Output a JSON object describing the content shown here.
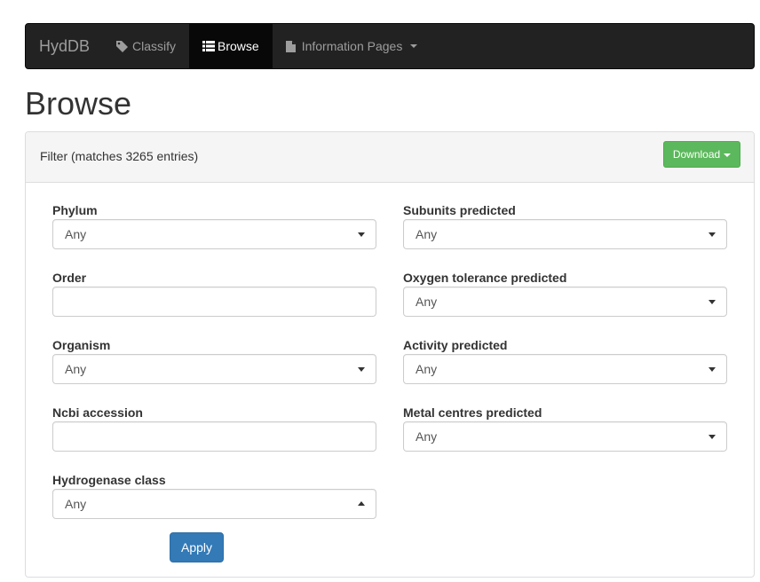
{
  "navbar": {
    "brand": "HydDB",
    "items": [
      {
        "label": "Classify",
        "icon": "tag-icon",
        "active": false
      },
      {
        "label": "Browse",
        "icon": "list-icon",
        "active": true
      },
      {
        "label": "Information Pages",
        "icon": "file-icon",
        "active": false,
        "dropdown": true
      }
    ]
  },
  "page": {
    "title": "Browse"
  },
  "filter": {
    "heading": "Filter (matches 3265 entries)",
    "download_label": "Download",
    "apply_label": "Apply",
    "left": [
      {
        "label": "Phylum",
        "type": "select",
        "value": "Any"
      },
      {
        "label": "Order",
        "type": "text",
        "value": ""
      },
      {
        "label": "Organism",
        "type": "select",
        "value": "Any"
      },
      {
        "label": "Ncbi accession",
        "type": "text",
        "value": ""
      },
      {
        "label": "Hydrogenase class",
        "type": "select",
        "value": "Any"
      }
    ],
    "right": [
      {
        "label": "Subunits predicted",
        "type": "select",
        "value": "Any"
      },
      {
        "label": "Oxygen tolerance predicted",
        "type": "select",
        "value": "Any"
      },
      {
        "label": "Activity predicted",
        "type": "select",
        "value": "Any"
      },
      {
        "label": "Metal centres predicted",
        "type": "select",
        "value": "Any"
      }
    ]
  },
  "colors": {
    "navbar_bg": "#222222",
    "download_green": "#5cb85c",
    "apply_blue": "#337ab7"
  }
}
